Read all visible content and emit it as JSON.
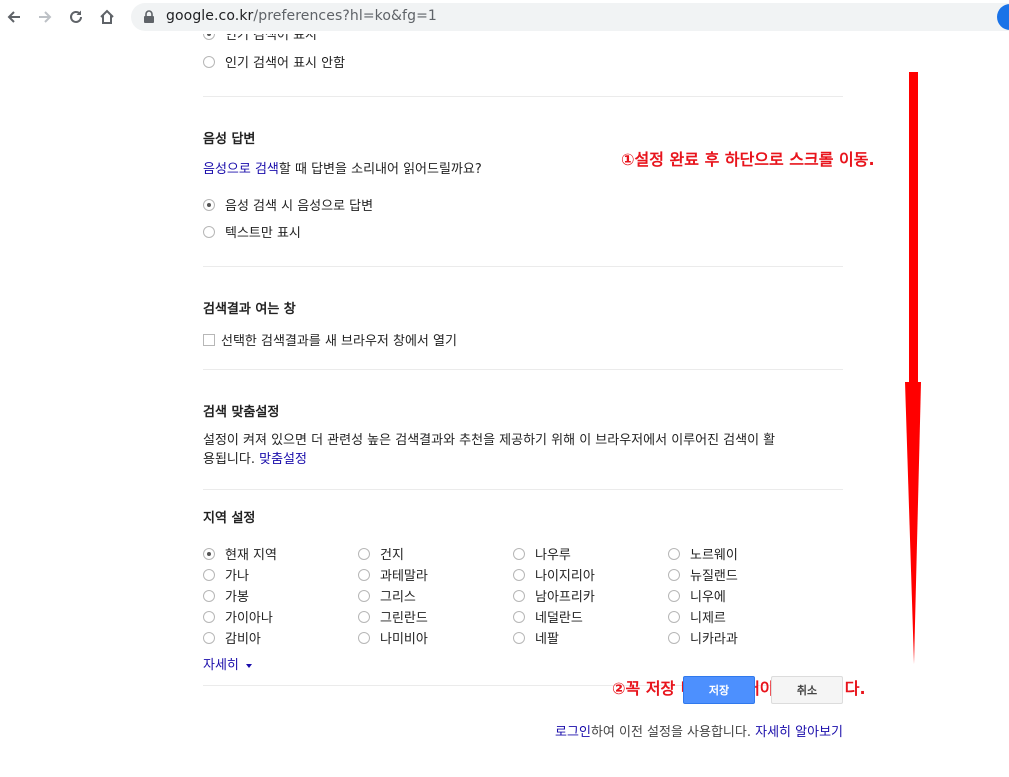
{
  "browser": {
    "url_domain": "google.co.kr",
    "url_path": "/preferences?hl=ko&fg=1"
  },
  "trending": {
    "show_label": "인기 검색어 표시",
    "hide_label": "인기 검색어 표시 안함"
  },
  "voice": {
    "title": "음성 답변",
    "question_link": "음성으로 검색",
    "question_rest": "할 때 답변을 소리내어 읽어드릴까요?",
    "option_voice": "음성 검색 시 음성으로 답변",
    "option_text": "텍스트만 표시"
  },
  "results_window": {
    "title": "검색결과 여는 창",
    "checkbox_label": "선택한 검색결과를 새 브라우저 창에서 열기"
  },
  "personalization": {
    "title": "검색 맞춤설정",
    "line1": "설정이 켜져 있으면 더 관련성 높은 검색결과와 추천을 제공하기 위해 이 브라우저에서 이루어진 검색이 활",
    "line2": "용됩니다.",
    "link": "맞춤설정"
  },
  "region": {
    "title": "지역 설정",
    "columns": [
      [
        "현재 지역",
        "가나",
        "가봉",
        "가이아나",
        "감비아"
      ],
      [
        "건지",
        "과테말라",
        "그리스",
        "그린란드",
        "나미비아"
      ],
      [
        "나우루",
        "나이지리아",
        "남아프리카",
        "네덜란드",
        "네팔"
      ],
      [
        "노르웨이",
        "뉴질랜드",
        "니우에",
        "니제르",
        "니카라과"
      ]
    ],
    "more_label": "자세히"
  },
  "annotations": {
    "step1": "①설정 완료 후 하단으로 스크롤 이동.",
    "step2": "②꼭 저장 버튼을 눌러야 반영 됩니다."
  },
  "buttons": {
    "save": "저장",
    "cancel": "취소"
  },
  "footer": {
    "login": "로그인",
    "middle": "하여 이전 설정을 사용합니다.",
    "learn_more": "자세히 알아보기"
  },
  "colors": {
    "annotation_red": "#e8141c",
    "save_blue": "#4d90fe",
    "link_blue": "#1a0dab"
  }
}
